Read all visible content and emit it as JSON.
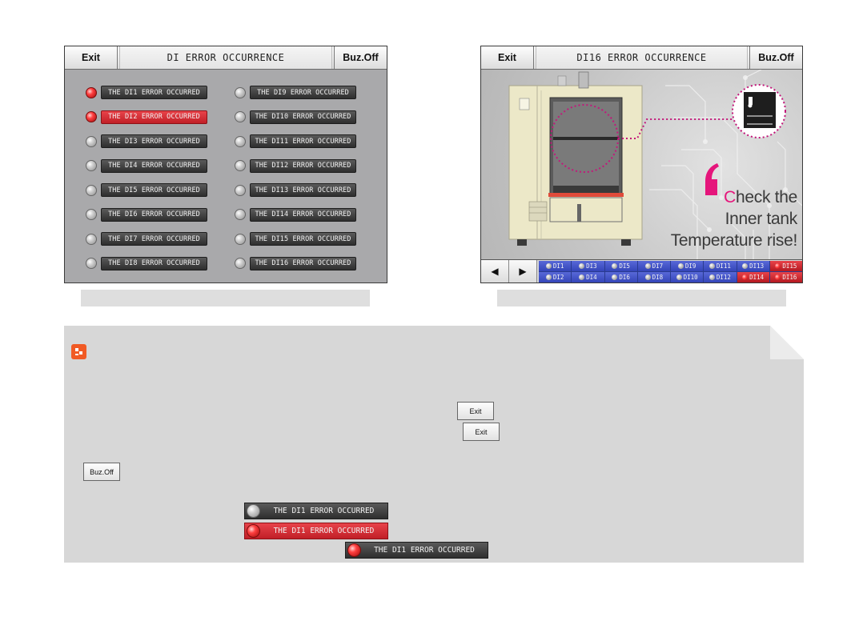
{
  "left_screen": {
    "exit_label": "Exit",
    "title": "DI ERROR OCCURRENCE",
    "buz_label": "Buz.Off",
    "errors": [
      {
        "label": "THE DI1 ERROR OCCURRED",
        "state": "on"
      },
      {
        "label": "THE DI2 ERROR OCCURRED",
        "state": "on"
      },
      {
        "label": "THE DI3 ERROR OCCURRED",
        "state": "off"
      },
      {
        "label": "THE DI4 ERROR OCCURRED",
        "state": "off"
      },
      {
        "label": "THE DI5 ERROR OCCURRED",
        "state": "off"
      },
      {
        "label": "THE DI6 ERROR OCCURRED",
        "state": "off"
      },
      {
        "label": "THE DI7 ERROR OCCURRED",
        "state": "off"
      },
      {
        "label": "THE DI8 ERROR OCCURRED",
        "state": "off"
      },
      {
        "label": "THE DI9 ERROR OCCURRED",
        "state": "off"
      },
      {
        "label": "THE DI10 ERROR OCCURRED",
        "state": "off"
      },
      {
        "label": "THE DI11 ERROR OCCURRED",
        "state": "off"
      },
      {
        "label": "THE DI12 ERROR OCCURRED",
        "state": "off"
      },
      {
        "label": "THE DI13 ERROR OCCURRED",
        "state": "off"
      },
      {
        "label": "THE DI14 ERROR OCCURRED",
        "state": "off"
      },
      {
        "label": "THE DI15 ERROR OCCURRED",
        "state": "off"
      },
      {
        "label": "THE DI16 ERROR OCCURRED",
        "state": "off"
      }
    ],
    "label_highlight": [
      "DI2"
    ]
  },
  "right_screen": {
    "exit_label": "Exit",
    "title": "DI16 ERROR OCCURRENCE",
    "buz_label": "Buz.Off",
    "message_line1_first": "C",
    "message_line1_rest": "heck the",
    "message_line2": "Inner tank",
    "message_line3": "Temperature rise!",
    "nav_prev": "◀",
    "nav_next": "▶",
    "di_top": [
      {
        "label": "DI1",
        "state": "off"
      },
      {
        "label": "DI3",
        "state": "off"
      },
      {
        "label": "DI5",
        "state": "off"
      },
      {
        "label": "DI7",
        "state": "off"
      },
      {
        "label": "DI9",
        "state": "off"
      },
      {
        "label": "DI11",
        "state": "off"
      },
      {
        "label": "DI13",
        "state": "off"
      },
      {
        "label": "DI15",
        "state": "on"
      }
    ],
    "di_bottom": [
      {
        "label": "DI2",
        "state": "off"
      },
      {
        "label": "DI4",
        "state": "off"
      },
      {
        "label": "DI6",
        "state": "off"
      },
      {
        "label": "DI8",
        "state": "off"
      },
      {
        "label": "DI10",
        "state": "off"
      },
      {
        "label": "DI12",
        "state": "off"
      },
      {
        "label": "DI14",
        "state": "on"
      },
      {
        "label": "DI16",
        "state": "on"
      }
    ],
    "colors": {
      "accent_magenta": "#e5157b",
      "dot_line": "#c2187a"
    }
  },
  "note": {
    "icon": "bullet-square-icon",
    "exit_btn_1": "Exit",
    "exit_btn_2": "Exit",
    "buz_btn": "Buz.Off",
    "sample_off": "THE DI1 ERROR OCCURRED",
    "sample_red": "THE DI1 ERROR OCCURRED",
    "sample_lamp_only": "THE DI1 ERROR OCCURRED"
  }
}
